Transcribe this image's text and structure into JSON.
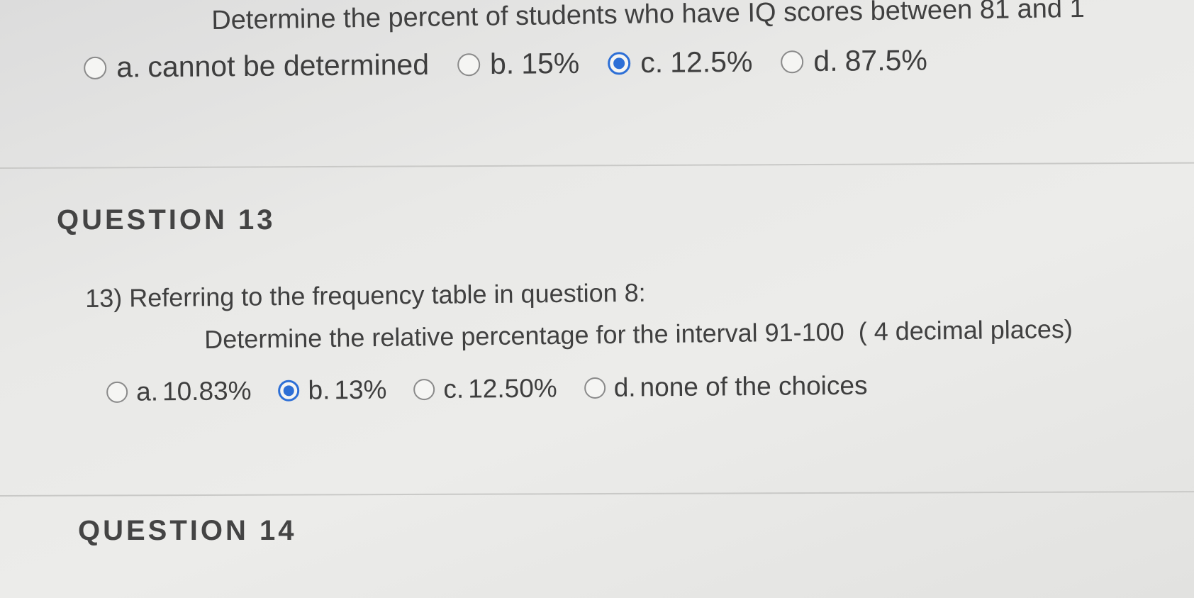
{
  "previous_question": {
    "prompt": "Determine the percent of students who have IQ scores between 81 and 1",
    "choices": [
      {
        "letter": "a.",
        "text": "cannot be determined",
        "selected": false
      },
      {
        "letter": "b.",
        "text": "15%",
        "selected": false
      },
      {
        "letter": "c.",
        "text": "12.5%",
        "selected": true
      },
      {
        "letter": "d.",
        "text": "87.5%",
        "selected": false
      }
    ]
  },
  "question_13": {
    "heading": "QUESTION 13",
    "prompt_line1": "13) Referring to the frequency table in question 8:",
    "prompt_line2": "Determine the relative percentage for the interval 91-100  ( 4 decimal places)",
    "choices": [
      {
        "letter": "a.",
        "text": "10.83%",
        "selected": false
      },
      {
        "letter": "b.",
        "text": "13%",
        "selected": true
      },
      {
        "letter": "c.",
        "text": "12.50%",
        "selected": false
      },
      {
        "letter": "d.",
        "text": "none of the choices",
        "selected": false
      }
    ]
  },
  "question_14": {
    "heading": "QUESTION 14"
  },
  "colors": {
    "selected_radio": "#2d6fd6",
    "text": "#404040",
    "background": "#e9e9e7"
  },
  "icons": {
    "unselected": "radio-unchecked-icon",
    "selected": "radio-checked-icon"
  }
}
